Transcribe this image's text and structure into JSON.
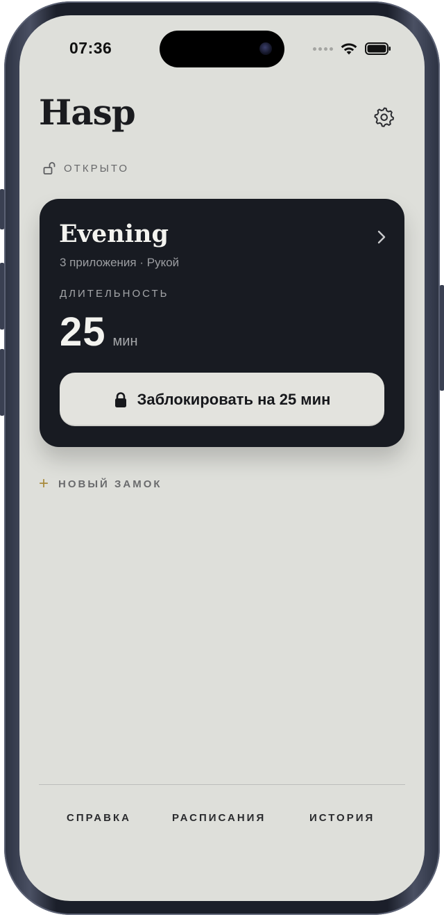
{
  "status_bar": {
    "time": "07:36",
    "wifi_icon": "wifi-icon",
    "battery_icon": "battery-icon"
  },
  "header": {
    "title": "Hasp",
    "settings_icon": "gear-icon"
  },
  "lock_status": {
    "icon": "unlocked-padlock-icon",
    "text": "ОТКРЫТО"
  },
  "lock_card": {
    "name": "Evening",
    "subtitle": "3 приложения · Рукой",
    "chevron_icon": "chevron-right-icon",
    "duration_label": "ДЛИТЕЛЬНОСТЬ",
    "duration_value": "25",
    "duration_unit": "мин",
    "lock_button_icon": "padlock-icon",
    "lock_button_label": "Заблокировать на 25 мин"
  },
  "new_lock": {
    "icon": "plus-icon",
    "label": "НОВЫЙ ЗАМОК"
  },
  "tabs": [
    {
      "label": "СПРАВКА"
    },
    {
      "label": "РАСПИСАНИЯ"
    },
    {
      "label": "ИСТОРИЯ"
    }
  ],
  "colors": {
    "background": "#dedfda",
    "card": "#181b22",
    "accent_plus": "#a88a3a",
    "button": "#e3e3de"
  }
}
